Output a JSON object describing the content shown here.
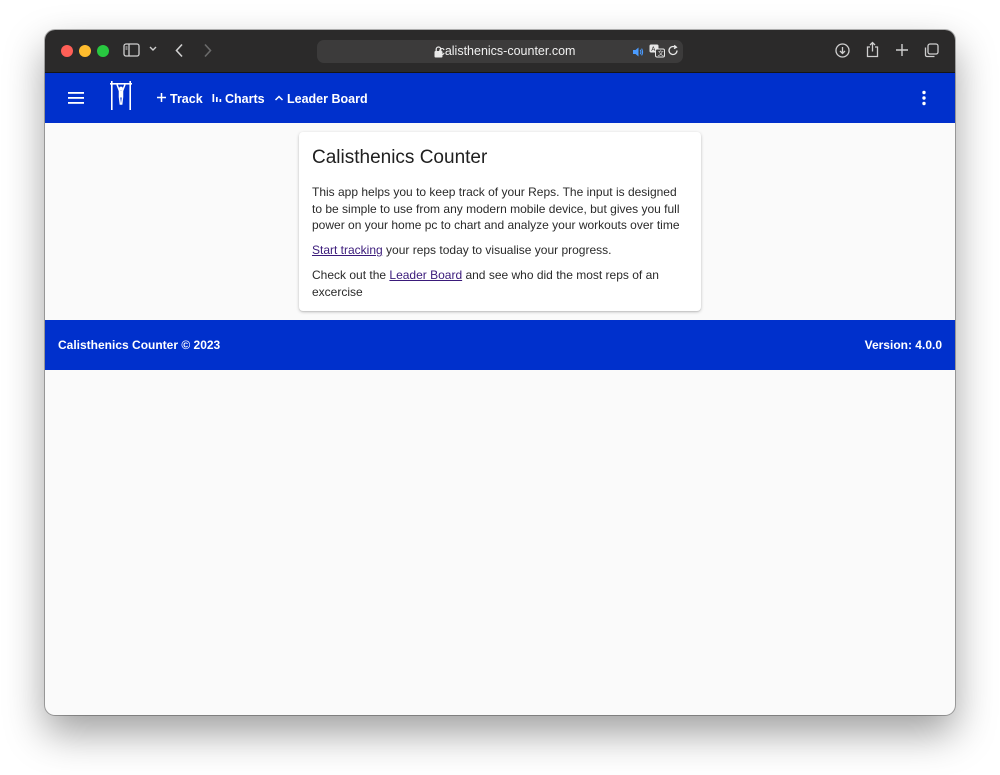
{
  "browser": {
    "url": "calisthenics-counter.com"
  },
  "nav": {
    "track_label": "Track",
    "charts_label": "Charts",
    "leaderboard_label": "Leader Board"
  },
  "card": {
    "title": "Calisthenics Counter",
    "intro": "This app helps you to keep track of your Reps. The input is designed to be simple to use from any modern mobile device, but gives you full power on your home pc to chart and analyze your workouts over time",
    "start_link": "Start tracking",
    "start_rest": " your reps today to visualise your progress.",
    "leader_prefix": "Check out the ",
    "leader_link": "Leader Board",
    "leader_rest": " and see who did the most reps of an excercise"
  },
  "footer": {
    "copyright": "Calisthenics Counter © 2023",
    "version": "Version: 4.0.0"
  },
  "colors": {
    "brand_blue": "#0030cc",
    "link": "#3a1a7a"
  }
}
